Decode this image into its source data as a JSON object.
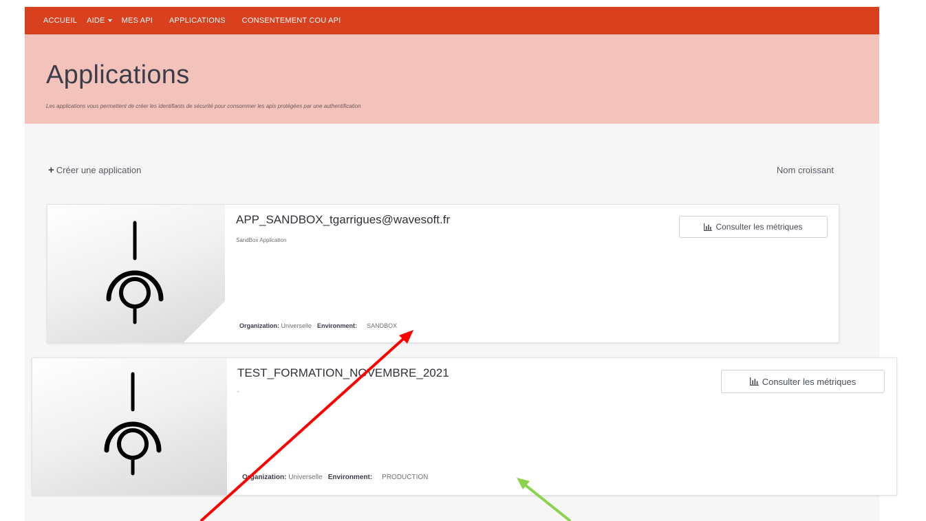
{
  "nav": {
    "items": [
      {
        "label": "ACCUEIL"
      },
      {
        "label": "AIDE"
      },
      {
        "label": "MES API"
      },
      {
        "label": "APPLICATIONS"
      },
      {
        "label": "CONSENTEMENT COU API"
      }
    ]
  },
  "hero": {
    "title": "Applications",
    "subtitle": "Les applications vous permettent de créer les identifiants de sécurité pour consommer les apis protégées par une authentification"
  },
  "toolbar": {
    "create_label": "Créer une application",
    "sort_label": "Nom croissant"
  },
  "applications": [
    {
      "name": "APP_SANDBOX_tgarrigues@wavesoft.fr",
      "description": "SandBox Application",
      "organization_key": "Organization:",
      "organization": "Universelle",
      "environment_key": "Environment:",
      "environment": "SANDBOX",
      "metrics_label": "Consulter les métriques"
    },
    {
      "name": "TEST_FORMATION_NOVEMBRE_2021",
      "description": "-",
      "organization_key": "Organization:",
      "organization": "Universelle",
      "environment_key": "Environment:",
      "environment": "PRODUCTION",
      "metrics_label": "Consulter les métriques"
    }
  ],
  "colors": {
    "nav_bg": "#d8401e",
    "hero_bg": "#f3c2bb",
    "arrow_red": "#ff0000",
    "arrow_green": "#8bd34a"
  },
  "icons": [
    "plus-icon",
    "bar-chart-icon",
    "app-logo-icon"
  ]
}
